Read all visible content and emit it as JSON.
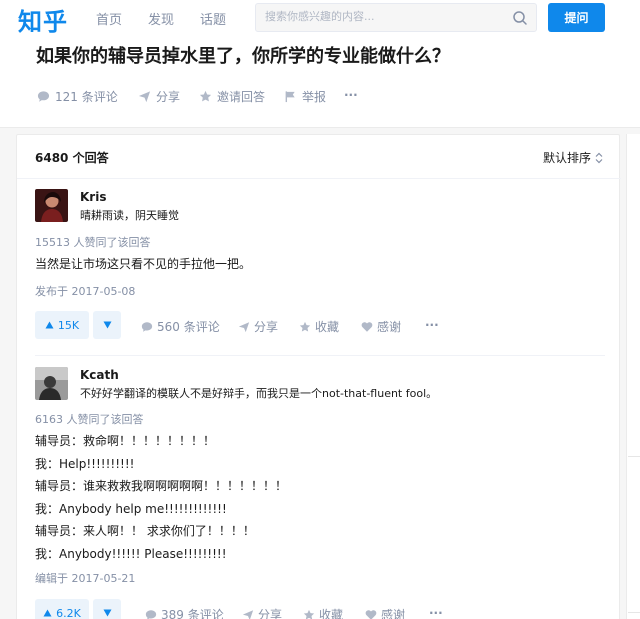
{
  "nav": {
    "logo": "知乎",
    "items": [
      "首页",
      "发现",
      "话题"
    ],
    "search_placeholder": "搜索你感兴趣的内容...",
    "ask_label": "提问"
  },
  "question": {
    "title": "如果你的辅导员掉水里了，你所学的专业能做什么？",
    "actions": {
      "comments": "121 条评论",
      "share": "分享",
      "invite": "邀请回答",
      "report": "举报",
      "more": "···"
    }
  },
  "answers_header": {
    "count": "6480 个回答",
    "sort": "默认排序"
  },
  "answers": [
    {
      "author": "Kris",
      "bio": "晴耕雨读，阴天睡觉",
      "votes_text": "15513 人赞同了该回答",
      "lines": [
        "当然是让市场这只看不见的手拉他一把。"
      ],
      "date": "发布于 2017-05-08",
      "upvote": "15K",
      "comments": "560 条评论",
      "share": "分享",
      "favorite": "收藏",
      "thanks": "感谢",
      "more": "···"
    },
    {
      "author": "Kcath",
      "bio": "不好好学翻译的模联人不是好辩手，而我只是一个not-that-fluent fool。",
      "votes_text": "6163 人赞同了该回答",
      "lines": [
        "辅导员：救命啊！！！！！！！！",
        "我：Help!!!!!!!!!!",
        "辅导员：谁来救救我啊啊啊啊啊！！！！！！！",
        "我：Anybody help me!!!!!!!!!!!!!",
        "辅导员：来人啊！！ 求求你们了！！！！",
        "我：Anybody!!!!!! Please!!!!!!!!!"
      ],
      "date": "编辑于 2017-05-21",
      "upvote": "6.2K",
      "comments": "389 条评论",
      "share": "分享",
      "favorite": "收藏",
      "thanks": "感谢",
      "more": "···"
    }
  ],
  "colors": {
    "brand": "#0f88eb",
    "muted": "#8590a6",
    "text": "#1a1a1a"
  }
}
